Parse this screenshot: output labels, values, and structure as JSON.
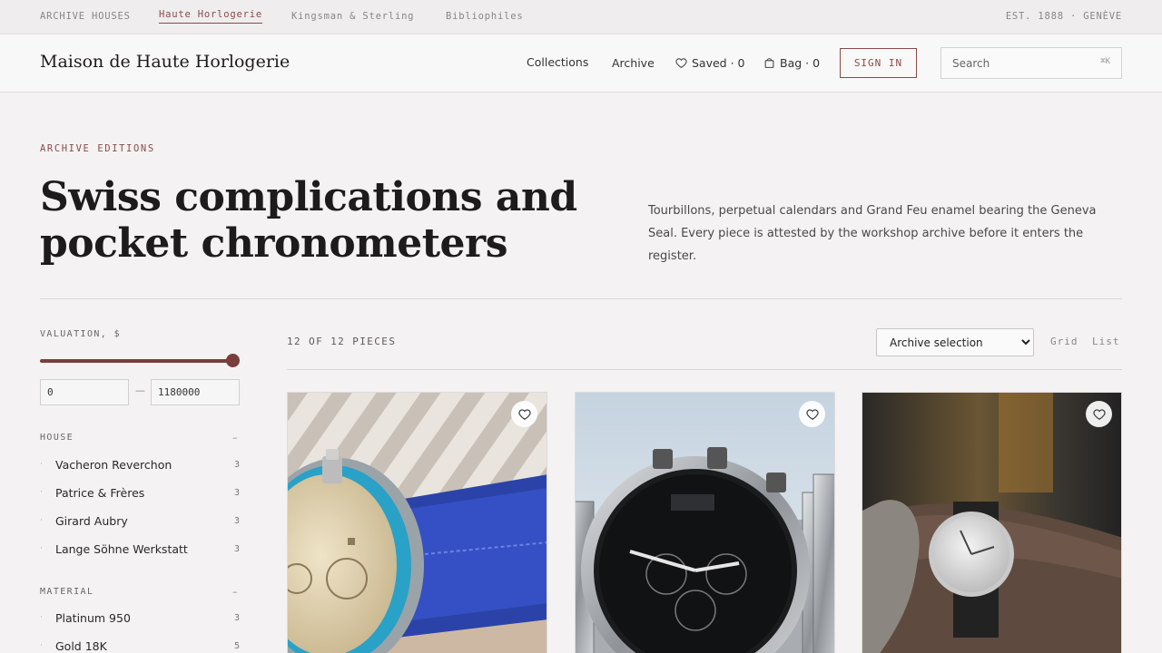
{
  "topbar": {
    "items": [
      "ARCHIVE HOUSES",
      "Haute Horlogerie",
      "Kingsman & Sterling",
      "Bibliophiles"
    ],
    "right": "EST. 1888 · GENÈVE"
  },
  "header": {
    "brand": "Maison de Haute Horlogerie",
    "nav": {
      "collections": "Collections",
      "archive": "Archive",
      "saved": "Saved · 0",
      "bag": "Bag · 0"
    },
    "signin": "SIGN IN",
    "search_placeholder": "Search",
    "search_shortcut": "⌘K"
  },
  "hero": {
    "eyebrow": "ARCHIVE EDITIONS",
    "title": "Swiss complications and pocket chronometers",
    "description": "Tourbillons, perpetual calendars and Grand Feu enamel bearing the Geneva Seal. Every piece is attested by the workshop archive before it enters the register."
  },
  "sidebar": {
    "valuation_label": "VALUATION, $",
    "valuation_slider_level": 1.0,
    "min": "0",
    "max": "1180000",
    "dash": "—",
    "collapse": "–",
    "house_label": "HOUSE",
    "houses": [
      {
        "name": "Vacheron Reverchon",
        "count": "3"
      },
      {
        "name": "Patrice & Frères",
        "count": "3"
      },
      {
        "name": "Girard Aubry",
        "count": "3"
      },
      {
        "name": "Lange Söhne Werkstatt",
        "count": "3"
      }
    ],
    "material_label": "MATERIAL",
    "materials": [
      {
        "name": "Platinum 950",
        "count": "3"
      },
      {
        "name": "Gold 18K",
        "count": "5"
      }
    ]
  },
  "results": {
    "count": "12 OF 12 PIECES",
    "sort": "Archive selection",
    "views": [
      "Grid",
      "List"
    ]
  },
  "icons": {
    "saved": "heart-icon",
    "bag": "bag-icon",
    "favorite": "heart-icon"
  },
  "colors": {
    "accent": "#8a4a48",
    "slider": "#7a3e3c",
    "background": "#f4f2f3"
  }
}
